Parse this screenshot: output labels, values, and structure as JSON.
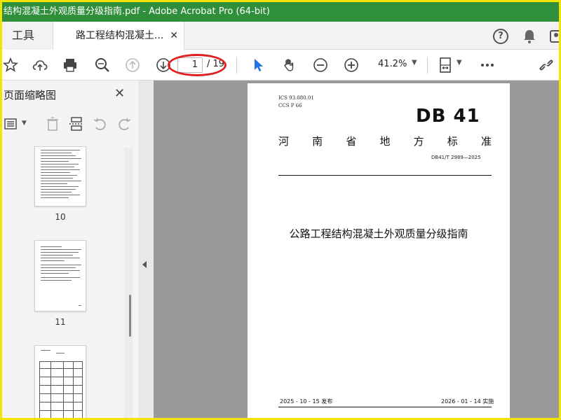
{
  "window": {
    "title": "结构混凝土外观质量分级指南.pdf - Adobe Acrobat Pro (64-bit)"
  },
  "tabs": {
    "tools_label": "工具",
    "doc_tab_label": "路工程结构混凝土...",
    "close_glyph": "✕"
  },
  "toolbar": {
    "current_page": "1",
    "total_pages": "/ 19",
    "zoom": "41.2%"
  },
  "sidebar": {
    "title": "页面缩略图",
    "thumbnails": [
      {
        "page": "10"
      },
      {
        "page": "11"
      }
    ]
  },
  "document": {
    "ics": "ICS  93.080.01",
    "ccs": "CCS  P  66",
    "db_logo": "DB 41",
    "standard_type_chars": [
      "河",
      "南",
      "省",
      "地",
      "方",
      "标",
      "准"
    ],
    "standard_number": "DB41/T  2989—2025",
    "title": "公路工程结构混凝土外观质量分级指南",
    "publish_date": "2025 - 10 - 15 发布",
    "implement_date": "2026 - 01 - 14 实施"
  },
  "colors": {
    "titlebar": "#2f8f3a",
    "frame": "#f2e600",
    "annotation": "#e02020",
    "select_tool": "#1a73e8"
  }
}
